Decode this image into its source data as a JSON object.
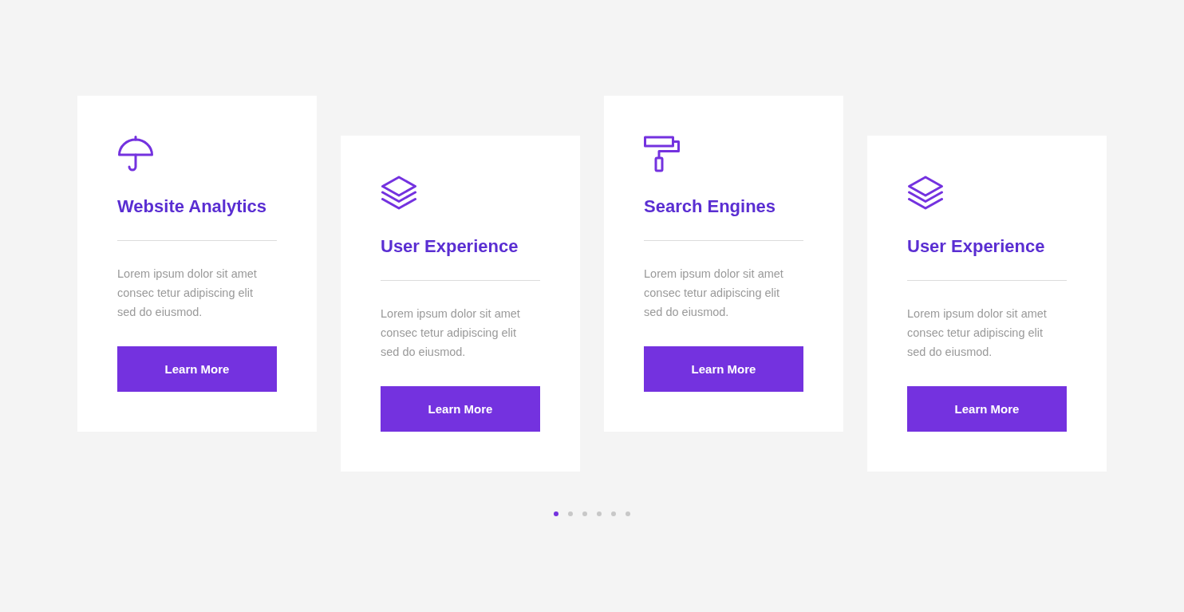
{
  "cards": [
    {
      "title": "Website Analytics",
      "text": "Lorem ipsum dolor sit amet consec tetur adipiscing elit sed do eiusmod.",
      "button": "Learn More"
    },
    {
      "title": "User Experience",
      "text": "Lorem ipsum dolor sit amet consec tetur adipiscing elit sed do eiusmod.",
      "button": "Learn More"
    },
    {
      "title": "Search Engines",
      "text": "Lorem ipsum dolor sit amet consec tetur adipiscing elit sed do eiusmod.",
      "button": "Learn More"
    },
    {
      "title": "User Experience",
      "text": "Lorem ipsum dolor sit amet consec tetur adipiscing elit sed do eiusmod.",
      "button": "Learn More"
    }
  ],
  "pagination": [
    {
      "selected": true
    },
    {
      "selected": false
    },
    {
      "selected": false
    },
    {
      "selected": false
    },
    {
      "selected": false
    },
    {
      "selected": false
    }
  ]
}
